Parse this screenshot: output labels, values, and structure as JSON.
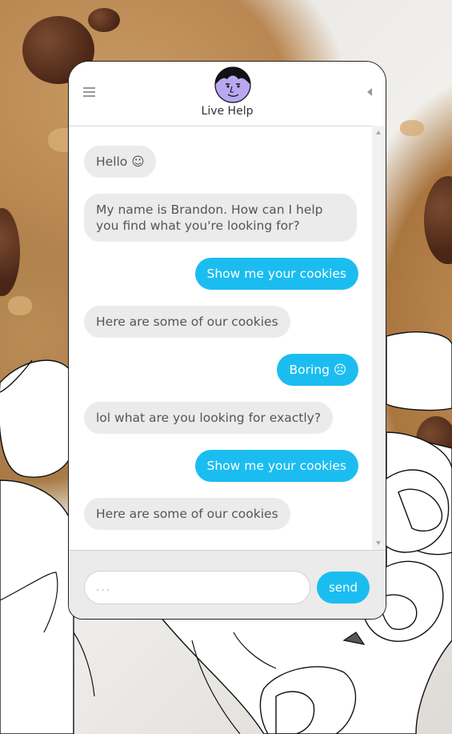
{
  "header": {
    "title": "Live Help",
    "menu_icon": "hamburger-menu-icon",
    "collapse_icon": "caret-left-icon",
    "avatar": "agent-avatar"
  },
  "messages": [
    {
      "from": "bot",
      "text": "Hello ☺"
    },
    {
      "from": "bot",
      "text": "My name is Brandon. How can I help you find what you're  looking for?"
    },
    {
      "from": "user",
      "text": "Show me your cookies"
    },
    {
      "from": "bot",
      "text": "Here are some of our cookies"
    },
    {
      "from": "user",
      "text": "Boring ☹"
    },
    {
      "from": "bot",
      "text": "lol what are you looking for exactly?"
    },
    {
      "from": "user",
      "text": "Show me your cookies"
    },
    {
      "from": "bot",
      "text": "Here are some of our cookies"
    }
  ],
  "composer": {
    "placeholder": "...",
    "send_label": "send"
  },
  "colors": {
    "accent": "#1bbdf1",
    "bot_bubble": "#ebebeb",
    "avatar_bg": "#b8a8f2"
  }
}
